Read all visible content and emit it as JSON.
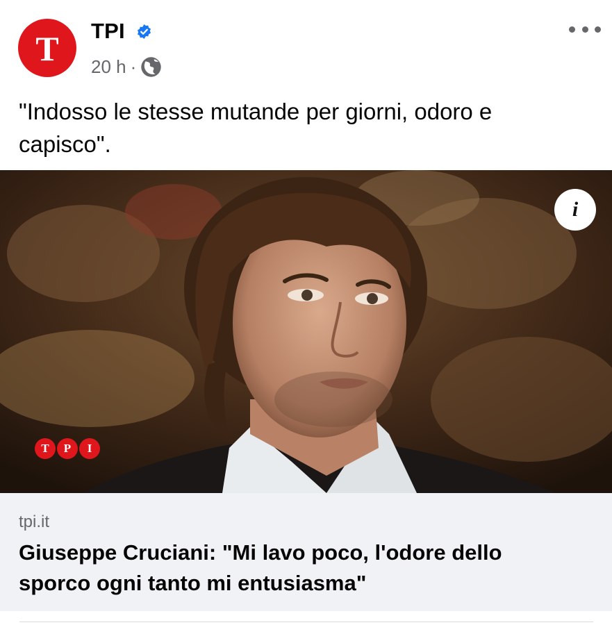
{
  "post": {
    "page_name": "TPI",
    "avatar_letter": "T",
    "timestamp": "20 h",
    "separator": "·",
    "caption": "\"Indosso le stesse mutande per giorni, odoro e capisco\".",
    "icons": {
      "verified": "verified-badge-icon",
      "audience": "globe-icon",
      "more": "more-options-icon",
      "info": "info-icon"
    }
  },
  "image": {
    "watermark_letters": [
      "T",
      "P",
      "I"
    ],
    "info_label": "i"
  },
  "link_preview": {
    "domain": "tpi.it",
    "title": "Giuseppe Cruciani: \"Mi lavo poco, l'odore dello sporco ogni tanto mi entusiasma\""
  },
  "colors": {
    "brand_red": "#e0161d",
    "verified_blue": "#1877f2",
    "secondary_text": "#65676b",
    "preview_background": "#f0f2f5"
  }
}
